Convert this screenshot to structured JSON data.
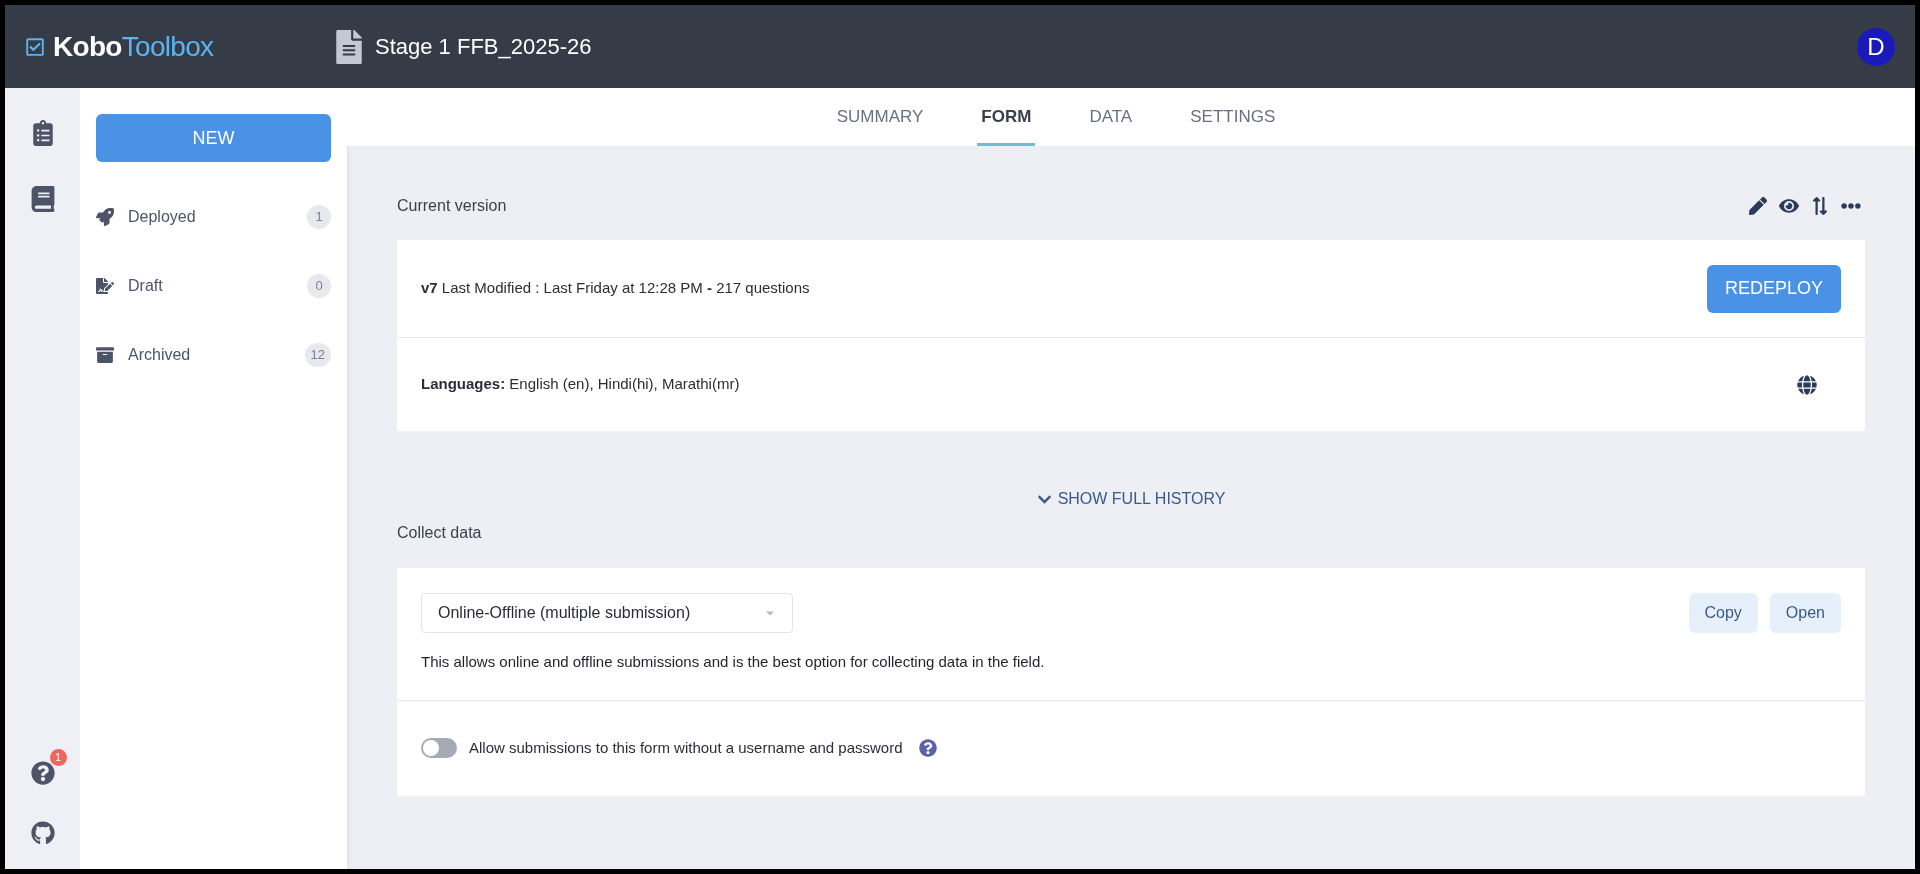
{
  "header": {
    "logo": {
      "strong": "Kobo",
      "light": "Toolbox"
    },
    "project_title": "Stage 1 FFB_2025-26",
    "avatar": "D"
  },
  "sidebar": {
    "new_button": "NEW",
    "items": [
      {
        "kind": "deployed",
        "label": "Deployed",
        "count": "1"
      },
      {
        "kind": "draft",
        "label": "Draft",
        "count": "0"
      },
      {
        "kind": "archived",
        "label": "Archived",
        "count": "12"
      }
    ]
  },
  "rail": {
    "help_badge": "1"
  },
  "tabs": [
    {
      "label": "SUMMARY",
      "selected": false
    },
    {
      "label": "FORM",
      "selected": true
    },
    {
      "label": "DATA",
      "selected": false
    },
    {
      "label": "SETTINGS",
      "selected": false
    }
  ],
  "current_version": {
    "heading": "Current version",
    "version_info": "**v7** Last Modified : Last Friday at 12:28 PM **-** 217 questions",
    "redeploy_button": "REDEPLOY",
    "languages": "**Languages:** English (en), Hindi(hi), Marathi(mr)"
  },
  "show_history": "SHOW FULL HISTORY",
  "collect_data": {
    "heading": "Collect data",
    "method": "Online-Offline (multiple submission)",
    "copy_button": "Copy",
    "open_button": "Open",
    "description": "This allows online and offline submissions and is the best option for collecting data in the field.",
    "anonymous_toggle": {
      "label": "Allow submissions to this form without a username and password",
      "on": false
    }
  }
}
